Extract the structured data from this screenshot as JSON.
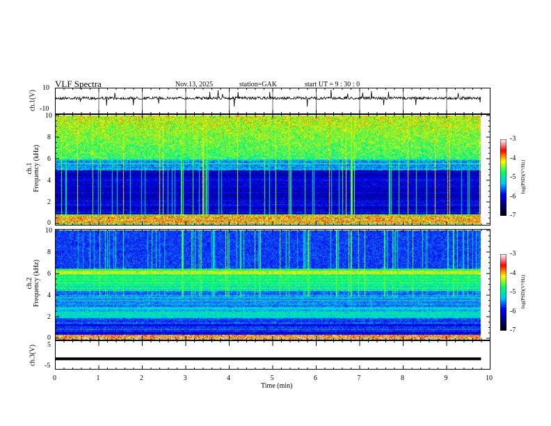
{
  "header": {
    "title": "VLF  Spectra",
    "date": "Nov.13, 2025",
    "station": "station=GAK",
    "start": "start  UT =   9  : 30 : 0"
  },
  "chart_data": [
    {
      "type": "line",
      "name": "ch1-waveform",
      "ylabel": "ch.1(V)",
      "ylim": [
        -10,
        10
      ],
      "yticks": [
        "10",
        "-10"
      ],
      "baseline": 0,
      "description_values": "noisy waveform around 0 V with spikes up to ~5 V"
    },
    {
      "type": "heatmap",
      "name": "ch1-spectrogram",
      "ylabel": "ch.1\nFrequency  (kHz)",
      "ylabel_lines": [
        "ch.1",
        "Frequency  (kHz)"
      ],
      "ylim": [
        0,
        10
      ],
      "yticks": [
        "0",
        "2",
        "4",
        "6",
        "8",
        "10"
      ],
      "colorbar": {
        "label": "log(PSD)(V²/Hz)",
        "range": [
          -7,
          -3
        ],
        "ticks": [
          "-3",
          "-4",
          "-5",
          "-6",
          "-7"
        ]
      }
    },
    {
      "type": "heatmap",
      "name": "ch2-spectrogram",
      "ylabel_lines": [
        "ch.2",
        "Frequency  (kHz)"
      ],
      "ylim": [
        0,
        10
      ],
      "yticks": [
        "0",
        "2",
        "4",
        "6",
        "8",
        "10"
      ],
      "colorbar": {
        "label": "log(PSD)(V²/Hz)",
        "range": [
          -7,
          -3
        ],
        "ticks": [
          "-3",
          "-4",
          "-5",
          "-6",
          "-7"
        ]
      }
    },
    {
      "type": "line",
      "name": "ch3-waveform",
      "ylabel": "ch.3(V)",
      "ylim": [
        -5,
        5
      ],
      "yticks": [
        "5",
        "-5"
      ],
      "level": -1.5
    }
  ],
  "xaxis": {
    "label": "Time  (min)",
    "xlim": [
      0,
      10
    ],
    "ticks": [
      "0",
      "1",
      "2",
      "3",
      "4",
      "5",
      "6",
      "7",
      "8",
      "9",
      "10"
    ],
    "data_end": 9.8
  },
  "colors": {
    "map": [
      "#000000",
      "#00007a",
      "#0000ff",
      "#00c8ff",
      "#00ff60",
      "#ffff00",
      "#ff0000",
      "#ffffff"
    ]
  }
}
